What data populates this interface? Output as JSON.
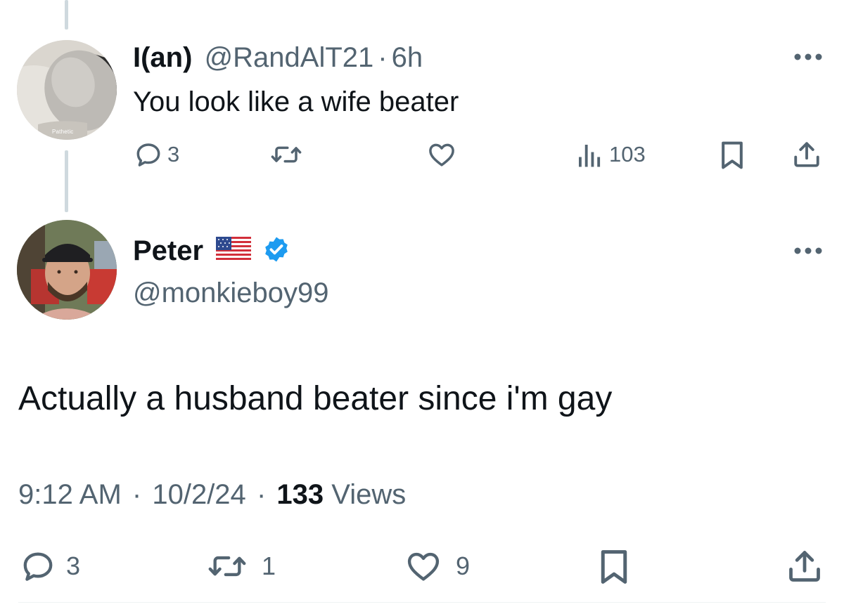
{
  "reply_tweet": {
    "display_name": "I(an)",
    "handle": "@RandAlT21",
    "separator": "·",
    "time_ago": "6h",
    "text": "You look like a wife beater",
    "avatar_caption": "Pathetic",
    "actions": {
      "reply_count": "3",
      "retweet_count": "",
      "like_count": "",
      "views_count": "103"
    }
  },
  "main_tweet": {
    "display_name": "Peter",
    "flag_emoji": "us-flag",
    "verified": true,
    "handle": "@monkieboy99",
    "text": "Actually a husband beater since i'm gay",
    "time": "9:12 AM",
    "sep1": "·",
    "date": "10/2/24",
    "sep2": "·",
    "views_count": "133",
    "views_label": "Views",
    "actions": {
      "reply_count": "3",
      "retweet_count": "1",
      "like_count": "9"
    }
  },
  "colors": {
    "text_primary": "#0f1419",
    "text_secondary": "#536471",
    "verified_blue": "#1d9bf0",
    "thread_line": "#cfd9de"
  }
}
